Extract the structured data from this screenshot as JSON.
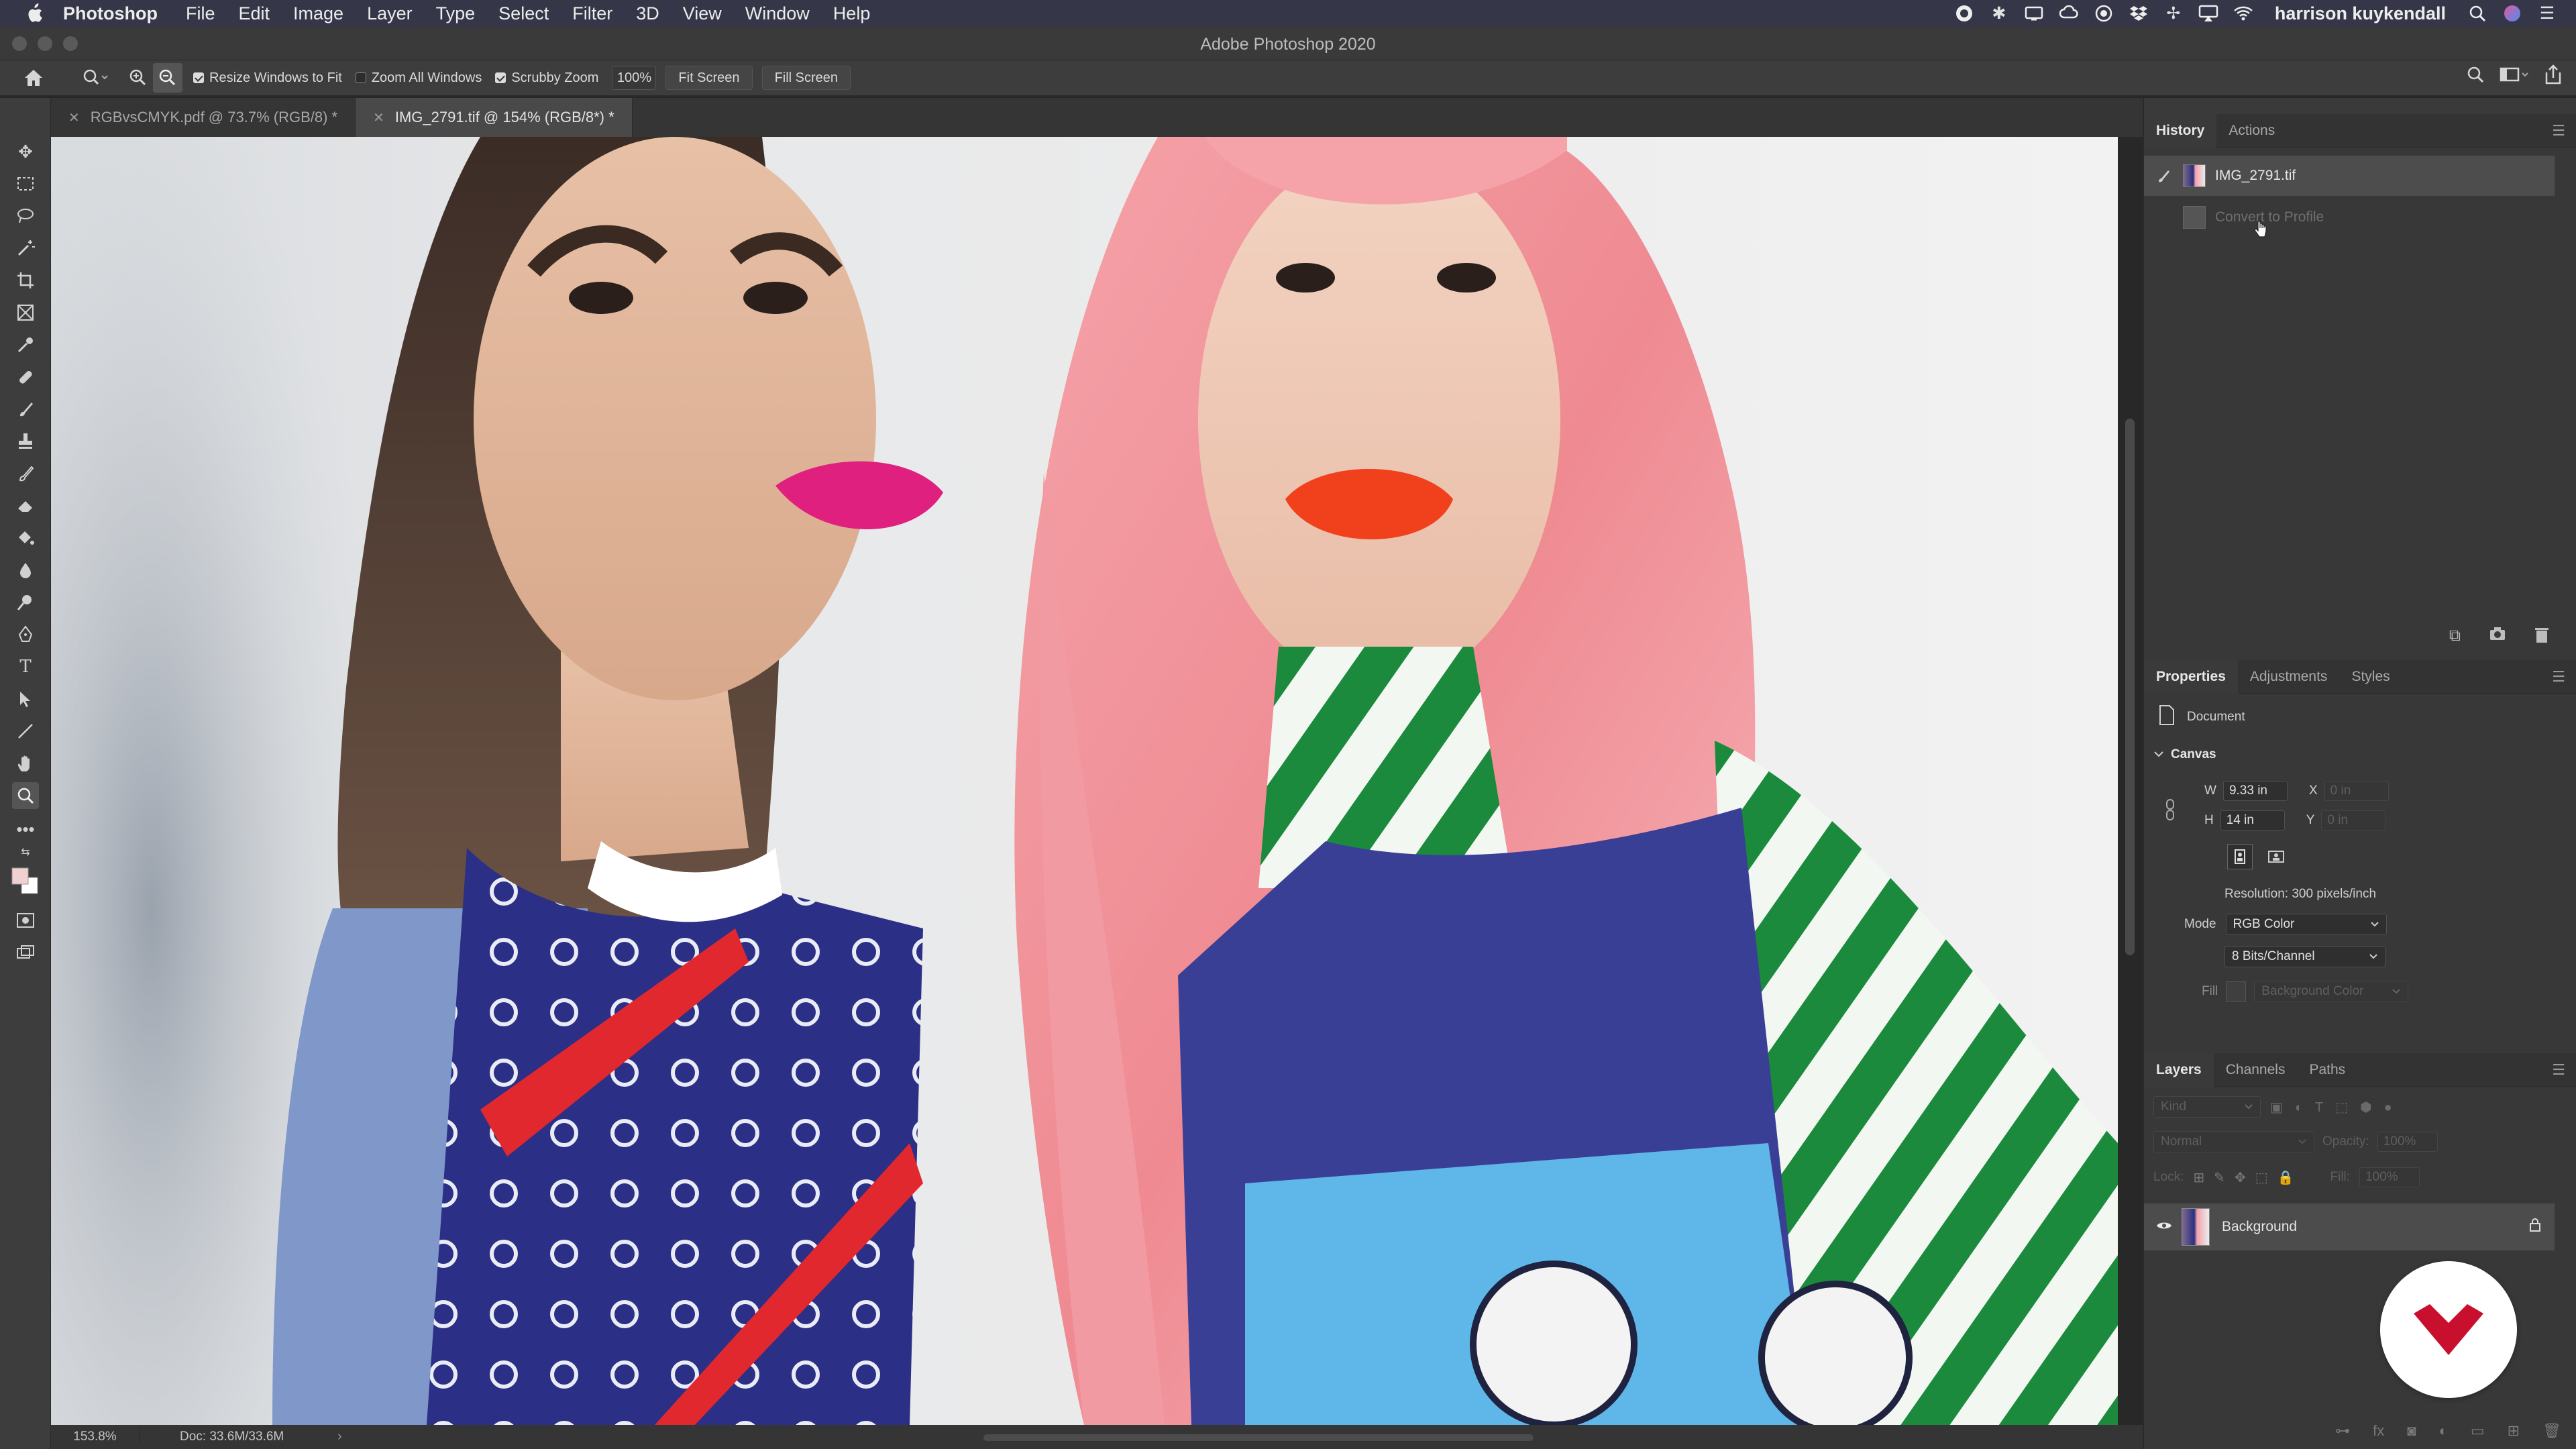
{
  "menubar": {
    "app_name": "Photoshop",
    "items": [
      "File",
      "Edit",
      "Image",
      "Layer",
      "Type",
      "Select",
      "Filter",
      "3D",
      "View",
      "Window",
      "Help"
    ],
    "user": "harrison kuykendall",
    "status_icons": [
      "record-icon",
      "bluetooth-icon",
      "screen-icon",
      "creative-cloud-icon",
      "sync-icon",
      "dropbox-icon",
      "grid-icon",
      "airplay-icon",
      "wifi-icon",
      "search-icon",
      "siri-icon",
      "list-icon"
    ]
  },
  "titlebar": {
    "title": "Adobe Photoshop 2020"
  },
  "options": {
    "resize_windows": "Resize Windows to Fit",
    "resize_windows_checked": true,
    "zoom_all": "Zoom All Windows",
    "zoom_all_checked": false,
    "scrubby": "Scrubby Zoom",
    "scrubby_checked": true,
    "zoom_value": "100%",
    "fit_screen": "Fit Screen",
    "fill_screen": "Fill Screen"
  },
  "tabs": [
    {
      "label": "RGBvsCMYK.pdf @ 73.7% (RGB/8) *",
      "active": false
    },
    {
      "label": "IMG_2791.tif @ 154% (RGB/8*) *",
      "active": true
    }
  ],
  "status": {
    "zoom": "153.8%",
    "doc": "Doc: 33.6M/33.6M",
    "arrow": "›"
  },
  "history_panel": {
    "tabs": [
      "History",
      "Actions"
    ],
    "items": [
      {
        "label": "IMG_2791.tif",
        "state": "current"
      },
      {
        "label": "Convert to Profile",
        "state": "undone"
      }
    ]
  },
  "properties_panel": {
    "tabs": [
      "Properties",
      "Adjustments",
      "Styles"
    ],
    "doc_label": "Document",
    "canvas_label": "Canvas",
    "w_label": "W",
    "w_value": "9.33 in",
    "h_label": "H",
    "h_value": "14 in",
    "x_label": "X",
    "x_value": "0 in",
    "y_label": "Y",
    "y_value": "0 in",
    "resolution": "Resolution: 300 pixels/inch",
    "mode_label": "Mode",
    "mode_value": "RGB Color",
    "bits_value": "8 Bits/Channel",
    "fill_label": "Fill",
    "fill_value": "Background Color"
  },
  "layers_panel": {
    "tabs": [
      "Layers",
      "Channels",
      "Paths"
    ],
    "kind_placeholder": "Kind",
    "blend_mode": "Normal",
    "opacity_label": "Opacity:",
    "opacity_value": "100%",
    "lock_label": "Lock:",
    "fill_label": "Fill:",
    "fill_value": "100%",
    "layers": [
      {
        "name": "Background",
        "visible": true,
        "locked": true
      }
    ]
  },
  "colors": {
    "menubar": "#353648",
    "panel": "#3a3a3a",
    "accent_badge": "#c8102e"
  }
}
